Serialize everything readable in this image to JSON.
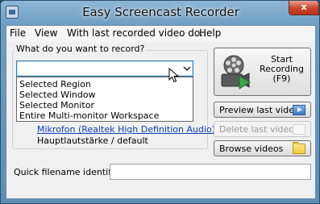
{
  "window": {
    "title": "Easy Screencast Recorder",
    "close_glyph": "x"
  },
  "menu": {
    "items": [
      "File",
      "View",
      "With last recorded video do..",
      "Help"
    ]
  },
  "record_group": {
    "label": "What do you want to record?",
    "selected": "",
    "options": [
      "Selected Region",
      "Selected Window",
      "Selected Monitor",
      "Entire Multi-monitor Workspace"
    ]
  },
  "audio": {
    "device_link": "Mikrofon (Realtek High Definition Audio)",
    "volume_text": "Hauptlautstärke / default"
  },
  "buttons": {
    "start_line1": "Start",
    "start_line2": "Recording",
    "start_line3": "(F9)",
    "preview": "Preview last video",
    "delete": "Delete last video",
    "browse": "Browse videos"
  },
  "quick_filename": {
    "label": "Quick filename identifier:",
    "value": ""
  },
  "icons": {
    "app": "film-app-icon",
    "reel": "film-reel-play-icon",
    "preview": "play-video-icon",
    "delete": "blank-icon",
    "browse": "folder-icon",
    "dropdown": "chevron-down-icon",
    "pointer": "mouse-pointer-icon"
  },
  "colors": {
    "link": "#0b3fb5",
    "focus_border": "#3c7fb1",
    "title_glass": "#6d9ec4",
    "close_red": "#c7442a",
    "play_green": "#3aa84a"
  }
}
